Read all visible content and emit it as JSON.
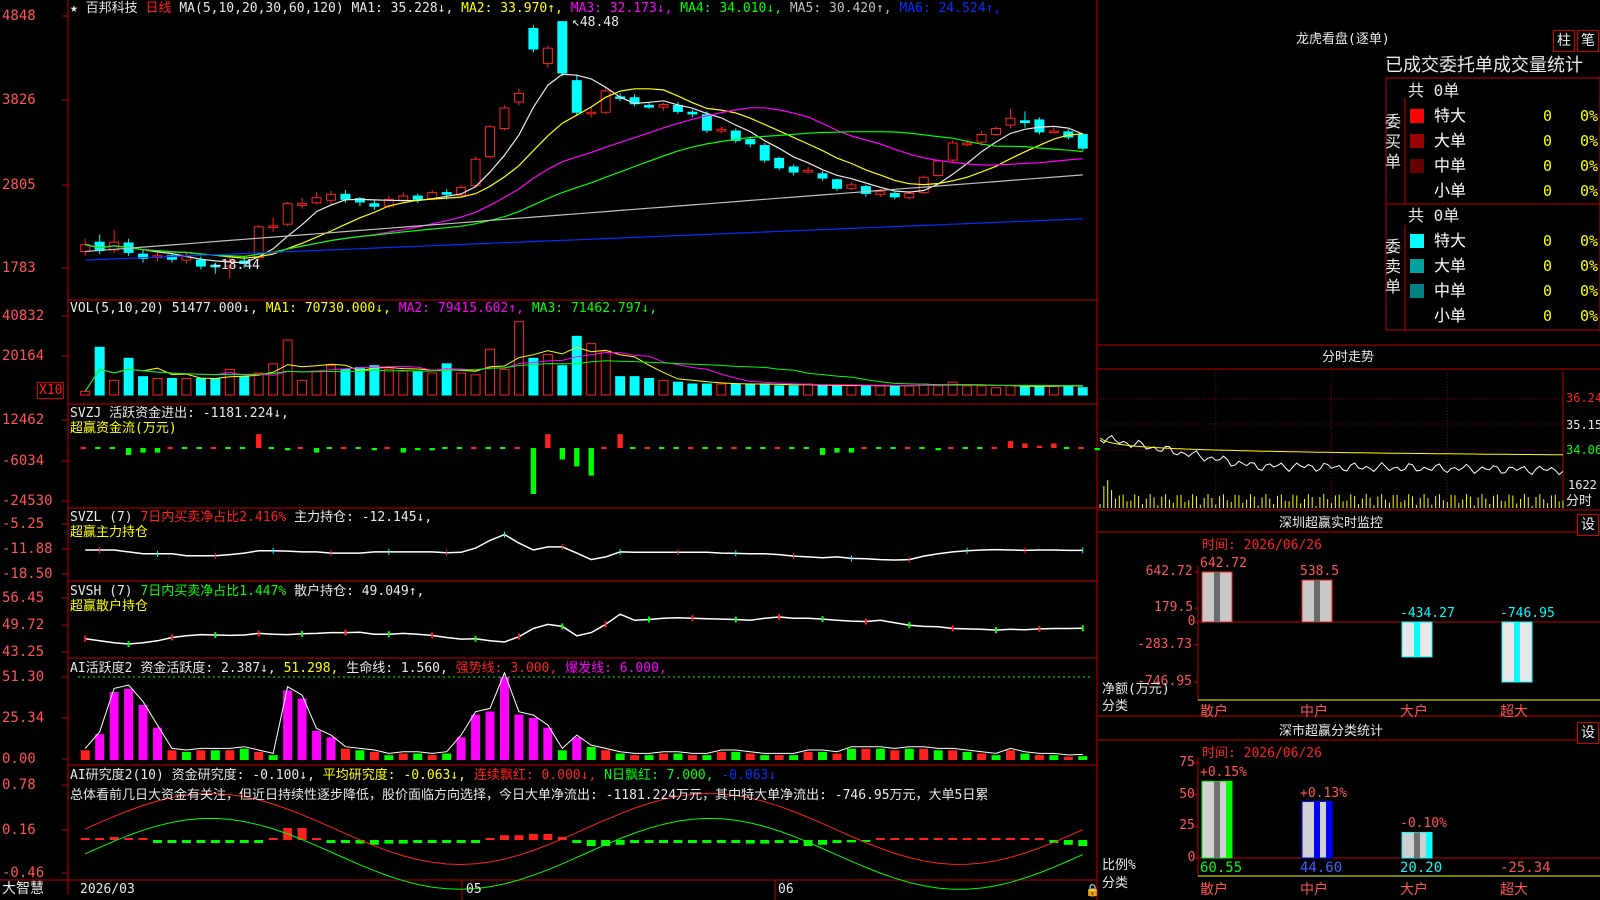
{
  "header": {
    "star": "★",
    "stock_name": "百邦科技",
    "period": "日线",
    "ma_title": "MA(5,10,20,30,60,120)",
    "ma_values": [
      {
        "label": "MA1: 35.228",
        "arrow": "↓",
        "color": "#e8e8e8"
      },
      {
        "label": "MA2: 33.970",
        "arrow": "↑",
        "color": "#ffff00"
      },
      {
        "label": "MA3: 32.173",
        "arrow": "↓",
        "color": "#ff00ff"
      },
      {
        "label": "MA4: 34.010",
        "arrow": "↓",
        "color": "#00ff00"
      },
      {
        "label": "MA5: 30.420",
        "arrow": "↑",
        "color": "#c0c0c0"
      },
      {
        "label": "MA6: 24.524",
        "arrow": "↑",
        "color": "#0030ff"
      }
    ]
  },
  "price_axis": [
    "4848",
    "3826",
    "2805",
    "1783"
  ],
  "price_annotations": {
    "high": "48.48",
    "low": "18.44"
  },
  "vol_panel": {
    "title": "VOL(5,10,20)",
    "value": "51477.000",
    "ma": [
      {
        "label": "MA1: 70730.000",
        "arrow": "↓",
        "color": "#ffff00"
      },
      {
        "label": "MA2: 79415.602",
        "arrow": "↑",
        "color": "#ff00ff"
      },
      {
        "label": "MA3: 71462.797",
        "arrow": "↓",
        "color": "#00ff00"
      }
    ],
    "axis": [
      "40832",
      "20164"
    ],
    "unit": "X10"
  },
  "svzj_panel": {
    "title": "SVZJ",
    "line1": "活跃资金进出: -1181.224↓,",
    "line2": "超赢资金流(万元)",
    "axis": [
      "12462",
      "-6034",
      "-24530"
    ]
  },
  "svzl_panel": {
    "title": "SVZL (7)",
    "desc": "7日内买卖净占比2.416%",
    "value": "主力持仓: -12.145↓,",
    "line2": "超赢主力持仓",
    "axis": [
      "-5.25",
      "-11.88",
      "-18.50"
    ]
  },
  "svsh_panel": {
    "title": "SVSH (7)",
    "desc": "7日内买卖净占比1.447%",
    "value": "散户持仓: 49.049↑,",
    "line2": "超赢散户持仓",
    "axis": [
      "56.45",
      "49.72",
      "43.25"
    ]
  },
  "ai_panel": {
    "title": "AI活跃度2",
    "v1": "资金活跃度: 2.387↓,",
    "v2": "51.298,",
    "v3": "生命线: 1.560,",
    "v4": "强势线: 3.000,",
    "v5": "爆发线: 6.000,",
    "axis": [
      "51.30",
      "25.34",
      "0.00"
    ]
  },
  "research_panel": {
    "title": "AI研究度2(10)",
    "v1": "资金研究度: -0.100↓,",
    "v2": "平均研究度: -0.063↓,",
    "v3": "连续飘红: 0.000↓,",
    "v4": "N日飘红: 7.000,",
    "v5": "-0.063↓",
    "summary": "总体看前几日大资金有关注，但近日持续性逐步降低，股价面临方向选择，今日大单净流出: -1181.224万元，其中特大单净流出: -746.95万元，大单5日累",
    "axis": [
      "0.78",
      "0.16",
      "-0.46"
    ]
  },
  "date_axis": [
    "2026/03",
    "05",
    "06"
  ],
  "brand": "大智慧",
  "dragon_panel": {
    "title": "龙虎看盘(逐单)",
    "btn1": "柱",
    "btn2": "笔",
    "subtitle": "已成交委托单成交量统计",
    "buy_label": "委买单",
    "sell_label": "委卖单",
    "buy_total": "共 0单",
    "sell_total": "共 0单",
    "buy_rows": [
      {
        "name": "特大",
        "count": "0",
        "pct": "0%",
        "color": "#ff0000"
      },
      {
        "name": "大单",
        "count": "0",
        "pct": "0%",
        "color": "#990000"
      },
      {
        "name": "中单",
        "count": "0",
        "pct": "0%",
        "color": "#660000"
      },
      {
        "name": "小单",
        "count": "0",
        "pct": "0%",
        "color": "#000000"
      }
    ],
    "sell_rows": [
      {
        "name": "特大",
        "count": "0",
        "pct": "0%",
        "color": "#00ffff"
      },
      {
        "name": "大单",
        "count": "0",
        "pct": "0%",
        "color": "#00a0a0"
      },
      {
        "name": "中单",
        "count": "0",
        "pct": "0%",
        "color": "#008080"
      },
      {
        "name": "小单",
        "count": "0",
        "pct": "0%",
        "color": "#000000"
      }
    ]
  },
  "intraday": {
    "title": "分时走势",
    "axis": [
      "36.24",
      "35.15",
      "34.06",
      "1622"
    ],
    "unit": "分时"
  },
  "monitor": {
    "title": "深圳超赢实时监控",
    "btn": "设",
    "time": "时间: 2026/06/26",
    "ylabel": "净额(万元)",
    "xlabel": "分类",
    "axis": [
      "642.72",
      "179.5",
      "0",
      "-283.73",
      "-746.95"
    ],
    "categories": [
      "散户",
      "中户",
      "大户",
      "超大"
    ],
    "values": [
      642.72,
      538.5,
      -434.27,
      -746.95
    ],
    "value_labels": [
      "642.72",
      "538.5",
      "-434.27",
      "-746.95"
    ]
  },
  "classify": {
    "title": "深市超赢分类统计",
    "btn": "设",
    "time": "时间: 2026/06/26",
    "ylabel": "比例%",
    "xlabel": "分类",
    "axis": [
      "75",
      "50",
      "25",
      "0"
    ],
    "categories": [
      "散户",
      "中户",
      "大户",
      "超大"
    ],
    "bottom_values": [
      "60.55",
      "44.60",
      "20.20",
      "-25.34"
    ],
    "change_labels": [
      "+0.15%",
      "+0.13%",
      "-0.10%",
      ""
    ],
    "values": [
      60.55,
      44.6,
      20.2,
      -25.34
    ]
  },
  "chart_data": {
    "type": "candlestick",
    "note_series": [
      "MA5",
      "MA10",
      "MA20",
      "MA30",
      "MA60",
      "MA120"
    ],
    "ylim": [
      17,
      50
    ],
    "candles": [
      [
        21.5,
        22.3,
        21.0,
        23.0
      ],
      [
        22.6,
        21.6,
        21.2,
        23.5
      ],
      [
        21.7,
        22.6,
        21.3,
        24.0
      ],
      [
        22.5,
        21.4,
        21.0,
        23.0
      ],
      [
        21.2,
        20.7,
        20.2,
        21.8
      ],
      [
        20.8,
        21.0,
        20.4,
        21.6
      ],
      [
        21.0,
        20.6,
        20.2,
        21.3
      ],
      [
        20.5,
        20.9,
        20.1,
        21.4
      ],
      [
        20.5,
        19.8,
        19.4,
        20.9
      ],
      [
        19.9,
        19.7,
        18.9,
        20.2
      ],
      [
        19.8,
        20.4,
        18.4,
        20.9
      ],
      [
        20.4,
        20.1,
        19.6,
        20.9
      ],
      [
        20.8,
        24.4,
        20.5,
        24.6
      ],
      [
        24.5,
        24.5,
        23.8,
        25.5
      ],
      [
        24.7,
        27.1,
        24.5,
        27.3
      ],
      [
        26.9,
        27.1,
        26.5,
        27.8
      ],
      [
        27.2,
        27.8,
        27.0,
        28.4
      ],
      [
        27.5,
        28.2,
        27.0,
        28.6
      ],
      [
        28.2,
        27.6,
        27.2,
        28.7
      ],
      [
        27.7,
        27.3,
        26.8,
        27.9
      ],
      [
        27.1,
        26.8,
        26.4,
        27.5
      ],
      [
        26.8,
        27.6,
        26.6,
        28.0
      ],
      [
        27.5,
        28.0,
        27.2,
        28.4
      ],
      [
        28.0,
        27.6,
        27.2,
        28.3
      ],
      [
        27.7,
        28.4,
        27.5,
        28.7
      ],
      [
        28.4,
        28.2,
        27.6,
        28.8
      ],
      [
        28.1,
        29.0,
        27.9,
        29.3
      ],
      [
        29.2,
        32.3,
        29.0,
        32.6
      ],
      [
        32.6,
        36.1,
        32.4,
        36.3
      ],
      [
        35.9,
        38.3,
        35.7,
        38.6
      ],
      [
        39.0,
        40.0,
        38.6,
        40.5
      ],
      [
        47.6,
        45.2,
        44.8,
        48.0
      ],
      [
        43.5,
        45.3,
        43.0,
        45.6
      ],
      [
        48.4,
        42.4,
        42.0,
        48.48
      ],
      [
        41.5,
        37.8,
        37.5,
        42.2
      ],
      [
        37.7,
        37.8,
        37.2,
        38.5
      ],
      [
        37.8,
        40.3,
        37.6,
        40.6
      ],
      [
        39.6,
        39.5,
        39.1,
        40.0
      ],
      [
        39.5,
        38.8,
        38.5,
        39.9
      ],
      [
        38.6,
        38.4,
        38.2,
        39.0
      ],
      [
        38.4,
        38.7,
        38.0,
        38.9
      ],
      [
        38.6,
        37.9,
        37.6,
        39.0
      ],
      [
        37.8,
        37.6,
        37.2,
        38.1
      ],
      [
        37.5,
        35.7,
        35.4,
        37.9
      ],
      [
        35.6,
        35.8,
        35.3,
        36.1
      ],
      [
        35.6,
        34.5,
        34.2,
        35.9
      ],
      [
        34.6,
        34.1,
        33.7,
        34.9
      ],
      [
        33.9,
        32.2,
        31.9,
        34.2
      ],
      [
        32.4,
        31.3,
        31.0,
        32.6
      ],
      [
        31.4,
        30.8,
        30.4,
        31.7
      ],
      [
        30.8,
        31.0,
        30.6,
        31.4
      ],
      [
        30.6,
        30.1,
        29.8,
        30.9
      ],
      [
        29.9,
        28.9,
        28.6,
        30.0
      ],
      [
        28.9,
        29.3,
        28.7,
        29.6
      ],
      [
        29.1,
        28.3,
        27.9,
        29.3
      ],
      [
        28.2,
        28.5,
        27.9,
        28.8
      ],
      [
        28.3,
        27.9,
        27.6,
        28.5
      ],
      [
        27.8,
        28.3,
        27.6,
        28.6
      ],
      [
        28.4,
        30.2,
        28.2,
        30.4
      ],
      [
        30.4,
        32.1,
        30.3,
        32.3
      ],
      [
        32.2,
        34.2,
        32.0,
        34.5
      ],
      [
        34.0,
        34.2,
        33.8,
        34.6
      ],
      [
        34.3,
        35.2,
        33.9,
        35.6
      ],
      [
        35.2,
        35.9,
        35.0,
        36.1
      ],
      [
        36.3,
        37.1,
        35.9,
        38.2
      ],
      [
        36.8,
        36.6,
        36.0,
        37.9
      ],
      [
        36.9,
        35.5,
        35.2,
        37.2
      ],
      [
        35.6,
        35.6,
        35.3,
        36.0
      ],
      [
        35.5,
        34.9,
        34.6,
        35.8
      ],
      [
        35.2,
        33.6,
        33.3,
        35.4
      ]
    ],
    "volume": [
      2,
      26,
      8,
      20,
      10,
      9,
      9,
      9,
      9,
      9,
      14,
      10,
      12,
      17,
      30,
      8,
      13,
      16,
      14,
      15,
      16,
      14,
      13,
      13,
      12,
      17,
      12,
      11,
      25,
      14,
      40,
      20,
      22,
      16,
      32,
      28,
      24,
      10,
      10,
      9,
      8,
      7,
      6,
      6,
      6,
      6,
      6,
      6,
      5,
      5,
      6,
      5,
      5,
      5,
      5,
      5,
      5,
      5,
      6,
      5,
      7,
      5,
      5,
      4,
      5,
      5,
      5,
      5,
      5,
      4
    ],
    "volume_ylim": [
      0,
      42
    ],
    "svzj": [
      0,
      0,
      0,
      -3,
      -2,
      -2,
      0,
      0,
      0,
      0,
      0,
      0,
      6,
      0,
      -1,
      0,
      -2,
      0,
      0,
      0,
      -1,
      0,
      -2,
      -1,
      -1,
      0,
      0,
      0,
      0,
      0,
      0,
      -20,
      6,
      -5,
      -8,
      -12,
      0,
      6,
      0,
      0,
      0,
      0,
      0,
      0,
      0,
      0,
      0,
      0,
      0,
      0,
      0,
      -3,
      -2,
      -2,
      0,
      0,
      0,
      0,
      0,
      -1,
      0,
      0,
      0,
      0,
      3,
      2,
      1,
      2,
      0,
      0,
      -1
    ],
    "svzj_ylim": [
      -24530,
      12462
    ],
    "svzl": [
      -12,
      -12,
      -12,
      -12.5,
      -13,
      -13,
      -13,
      -13.5,
      -13.5,
      -13.5,
      -13.2,
      -12.8,
      -12.2,
      -12.2,
      -12.3,
      -12.5,
      -12.5,
      -12.8,
      -12.8,
      -12.8,
      -12.5,
      -12.5,
      -12.5,
      -12.5,
      -12.5,
      -12.7,
      -12.6,
      -11.5,
      -9.5,
      -8.0,
      -10.2,
      -12.0,
      -11.2,
      -11.2,
      -12.8,
      -14.5,
      -13.8,
      -12.5,
      -12.6,
      -12.6,
      -12.6,
      -12.6,
      -12.6,
      -12.6,
      -12.8,
      -12.9,
      -13.0,
      -13.0,
      -13.2,
      -13.6,
      -13.8,
      -14.0,
      -13.8,
      -14.2,
      -14.3,
      -14.5,
      -14.6,
      -14.5,
      -13.6,
      -13.0,
      -12.5,
      -12.2,
      -12.0,
      -11.9,
      -12.0,
      -12.1,
      -12.0,
      -12.0,
      -12.1,
      -12.1
    ],
    "svzl_ylim": [
      -18.5,
      -5.25
    ],
    "svsh": [
      46.5,
      46.0,
      45.5,
      45.2,
      45.5,
      46.0,
      46.8,
      47.2,
      47.5,
      47.4,
      47.3,
      47.4,
      47.8,
      47.6,
      47.5,
      47.7,
      47.8,
      48.0,
      48.0,
      48.1,
      47.6,
      47.6,
      47.8,
      47.6,
      47.3,
      46.8,
      46.4,
      46.5,
      46.0,
      45.7,
      47.0,
      49.0,
      50.0,
      49.5,
      47.2,
      48.0,
      50.0,
      52.5,
      51.0,
      51.2,
      51.5,
      51.6,
      51.5,
      51.4,
      51.3,
      51.2,
      51.0,
      51.5,
      51.8,
      51.5,
      51.5,
      51.3,
      51.0,
      50.8,
      50.7,
      51.0,
      50.4,
      49.8,
      49.5,
      49.4,
      49.0,
      48.9,
      48.8,
      48.6,
      48.8,
      48.7,
      48.9,
      49.0,
      49.0,
      49.05
    ],
    "svsh_ylim": [
      43.25,
      56.45
    ],
    "ai_active": [
      6,
      16,
      42,
      44,
      34,
      20,
      6,
      5,
      6,
      6,
      6,
      7,
      5,
      3,
      43,
      38,
      18,
      14,
      7,
      6,
      5,
      3,
      4,
      4,
      3,
      4,
      14,
      28,
      30,
      51.3,
      28,
      26,
      20,
      6,
      14,
      8,
      6,
      4,
      3,
      3,
      4,
      4,
      3,
      3,
      5,
      5,
      4,
      3,
      3,
      3,
      5,
      5,
      4,
      7,
      7,
      7,
      6,
      7,
      7,
      6,
      6,
      5,
      4,
      3,
      6,
      4,
      3,
      3,
      2,
      2.4
    ],
    "ai_ylim": [
      0,
      51.3
    ],
    "research": [
      0.0,
      0.0,
      0.05,
      0.02,
      0.0,
      -0.05,
      -0.05,
      -0.05,
      -0.05,
      -0.05,
      -0.05,
      -0.05,
      -0.05,
      0.0,
      0.2,
      0.2,
      0.0,
      -0.05,
      -0.05,
      -0.06,
      -0.08,
      -0.06,
      -0.06,
      -0.05,
      -0.05,
      -0.05,
      -0.05,
      -0.05,
      0.02,
      0.08,
      0.08,
      0.1,
      0.1,
      0.05,
      -0.05,
      -0.1,
      -0.1,
      -0.08,
      -0.05,
      -0.05,
      -0.05,
      -0.05,
      -0.05,
      -0.05,
      -0.05,
      -0.05,
      -0.06,
      -0.06,
      -0.05,
      -0.05,
      -0.1,
      -0.08,
      -0.05,
      -0.04,
      -0.02,
      0.0,
      0.0,
      0.0,
      0.02,
      0.02,
      0.02,
      0.02,
      0.02,
      0.02,
      0.02,
      0.02,
      0.0,
      -0.05,
      -0.08,
      -0.1
    ],
    "research_ylim": [
      -0.46,
      0.78
    ]
  }
}
